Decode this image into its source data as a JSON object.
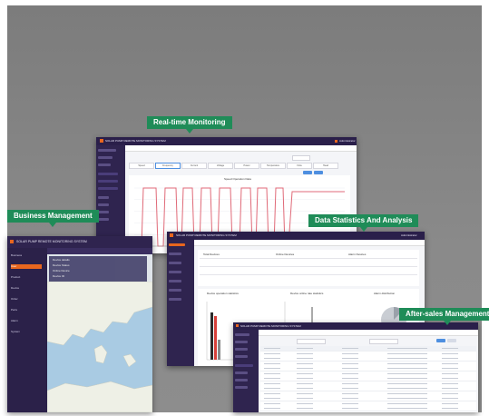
{
  "labels": {
    "realtime": "Real-time Monitoring",
    "business": "Business Management",
    "stats": "Data Statistics And Analysis",
    "aftersales": "After-sales Management"
  },
  "app": {
    "title": "SOLAR PUMP REMOTE MONITORING SYSTEM",
    "user": "Administrator"
  },
  "business_window": {
    "nav_items": [
      "Business",
      "User",
      "Product",
      "Device",
      "Order",
      "Parts",
      "Alarm",
      "System"
    ],
    "dropdown_rows": [
      "Device details",
      "Device Status",
      "Online Device",
      "Device ID"
    ]
  },
  "realtime_window": {
    "chart_title": "Speed Operation Data",
    "tabs": [
      "Speed",
      "Frequency",
      "Current",
      "Voltage",
      "Power",
      "Temperature",
      "Flow",
      "Head"
    ]
  },
  "stats_window": {
    "columns": [
      "Total Devices",
      "Online Devices",
      "Alarm Devices"
    ],
    "chart_titles": [
      "Device operation statistics",
      "Device online rate statistics",
      "Alarm distribution"
    ]
  },
  "colors": {
    "navy": "#2a1f4a",
    "accent_orange": "#e8661e",
    "tag_green": "#1f8c58",
    "line_red": "#e06a78"
  }
}
